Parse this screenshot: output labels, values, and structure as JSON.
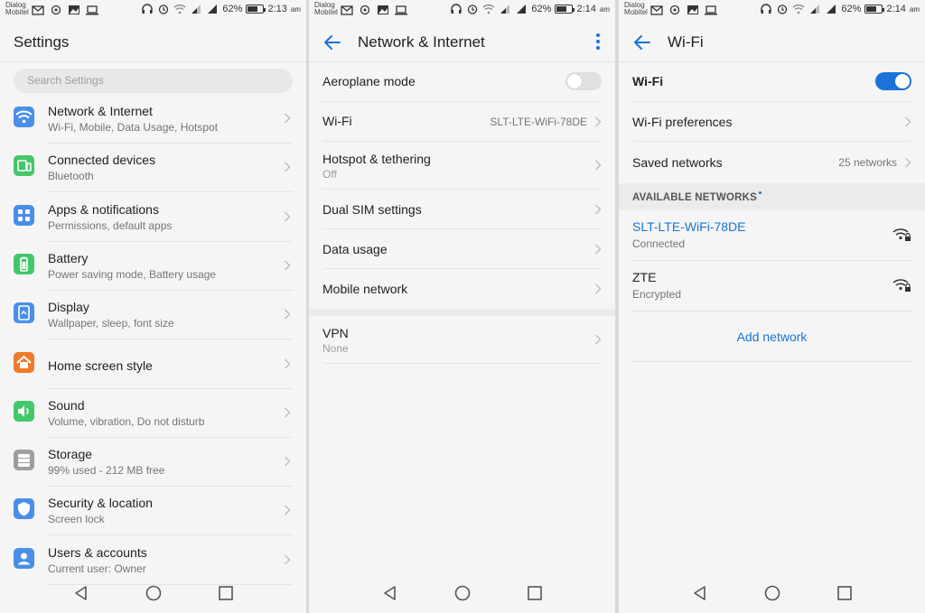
{
  "status_bar": {
    "carrier_line1": "Dialog",
    "carrier_line2": "Mobitel",
    "battery": "62%",
    "battery_level": 0.62,
    "screens_time": [
      "2:13",
      "2:14",
      "2:14"
    ],
    "ampm": "am"
  },
  "settings": {
    "title": "Settings",
    "search_placeholder": "Search Settings",
    "items": [
      {
        "label": "Network & Internet",
        "sub": "Wi-Fi, Mobile, Data Usage, Hotspot",
        "icon": "wifi-icon",
        "color": "#4a8fe7"
      },
      {
        "label": "Connected devices",
        "sub": "Bluetooth",
        "icon": "devices-icon",
        "color": "#42c86a"
      },
      {
        "label": "Apps & notifications",
        "sub": "Permissions, default apps",
        "icon": "apps-icon",
        "color": "#4a8fe7"
      },
      {
        "label": "Battery",
        "sub": "Power saving mode, Battery usage",
        "icon": "battery-icon",
        "color": "#42c86a"
      },
      {
        "label": "Display",
        "sub": "Wallpaper, sleep, font size",
        "icon": "display-icon",
        "color": "#4a8fe7"
      },
      {
        "label": "Home screen style",
        "sub": "",
        "icon": "home-icon",
        "color": "#f07a2a"
      },
      {
        "label": "Sound",
        "sub": "Volume, vibration, Do not disturb",
        "icon": "sound-icon",
        "color": "#42c86a"
      },
      {
        "label": "Storage",
        "sub": "99% used - 212 MB free",
        "icon": "storage-icon",
        "color": "#9e9e9e"
      },
      {
        "label": "Security & location",
        "sub": "Screen lock",
        "icon": "shield-icon",
        "color": "#4a8fe7"
      },
      {
        "label": "Users & accounts",
        "sub": "Current user: Owner",
        "icon": "user-icon",
        "color": "#4a8fe7"
      }
    ]
  },
  "network": {
    "title": "Network & Internet",
    "aeroplane": {
      "label": "Aeroplane mode",
      "enabled": false
    },
    "wifi": {
      "label": "Wi-Fi",
      "value": "SLT-LTE-WiFi-78DE"
    },
    "hotspot": {
      "label": "Hotspot & tethering",
      "sub": "Off"
    },
    "dual_sim": {
      "label": "Dual SIM settings"
    },
    "data_usage": {
      "label": "Data usage"
    },
    "mobile_network": {
      "label": "Mobile network"
    },
    "vpn": {
      "label": "VPN",
      "sub": "None"
    }
  },
  "wifi": {
    "title": "Wi-Fi",
    "toggle": {
      "label": "Wi-Fi",
      "enabled": true
    },
    "preferences": {
      "label": "Wi-Fi preferences"
    },
    "saved": {
      "label": "Saved networks",
      "value": "25 networks"
    },
    "available_header": "AVAILABLE NETWORKS",
    "networks": [
      {
        "name": "SLT-LTE-WiFi-78DE",
        "status": "Connected",
        "highlight": true
      },
      {
        "name": "ZTE",
        "status": "Encrypted",
        "highlight": false
      }
    ],
    "add_network": "Add network"
  },
  "colors": {
    "accent": "#1a73d9"
  }
}
